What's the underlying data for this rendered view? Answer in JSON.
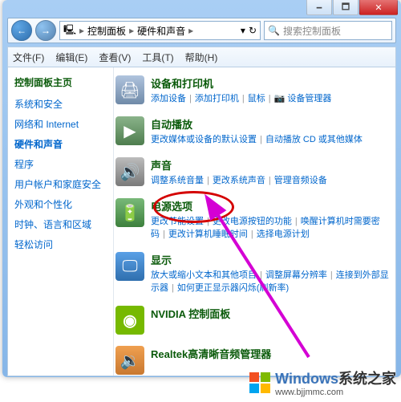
{
  "window": {
    "min": "🗕",
    "max": "🗖",
    "close": "✕"
  },
  "nav": {
    "back": "←",
    "fwd": "→",
    "crumb1": "控制面板",
    "crumb2": "硬件和声音",
    "dropdown": "▾",
    "refresh": "↻",
    "search_placeholder": "搜索控制面板"
  },
  "menu": {
    "file": "文件(F)",
    "edit": "编辑(E)",
    "view": "查看(V)",
    "tools": "工具(T)",
    "help": "帮助(H)"
  },
  "sidebar": {
    "head": "控制面板主页",
    "items": [
      "系统和安全",
      "网络和 Internet",
      "硬件和声音",
      "程序",
      "用户帐户和家庭安全",
      "外观和个性化",
      "时钟、语言和区域",
      "轻松访问"
    ],
    "active_index": 2
  },
  "main": {
    "cats": [
      {
        "icon": "printer",
        "glyph": "🖨",
        "title": "设备和打印机",
        "links": [
          "添加设备",
          "添加打印机",
          "鼠标",
          "📷 设备管理器"
        ]
      },
      {
        "icon": "autoplay",
        "glyph": "▶",
        "title": "自动播放",
        "links": [
          "更改媒体或设备的默认设置",
          "自动播放 CD 或其他媒体"
        ]
      },
      {
        "icon": "sound",
        "glyph": "🔊",
        "title": "声音",
        "links": [
          "调整系统音量",
          "更改系统声音",
          "管理音频设备"
        ]
      },
      {
        "icon": "power",
        "glyph": "🔋",
        "title": "电源选项",
        "links": [
          "更改节能设置",
          "更改电源按钮的功能",
          "唤醒计算机时需要密码",
          "更改计算机睡眠时间",
          "选择电源计划"
        ]
      },
      {
        "icon": "display",
        "glyph": "🖵",
        "title": "显示",
        "links": [
          "放大或缩小文本和其他项目",
          "调整屏幕分辨率",
          "连接到外部显示器",
          "如何更正显示器闪烁(刷新率)"
        ]
      },
      {
        "icon": "nvidia",
        "glyph": "◉",
        "title": "NVIDIA 控制面板",
        "links": []
      },
      {
        "icon": "realtek",
        "glyph": "🔉",
        "title": "Realtek高清晰音频管理器",
        "links": []
      }
    ]
  },
  "watermark": {
    "brand": "Windows",
    "sub": "系统之家",
    "url": "www.bjjmmc.com"
  }
}
